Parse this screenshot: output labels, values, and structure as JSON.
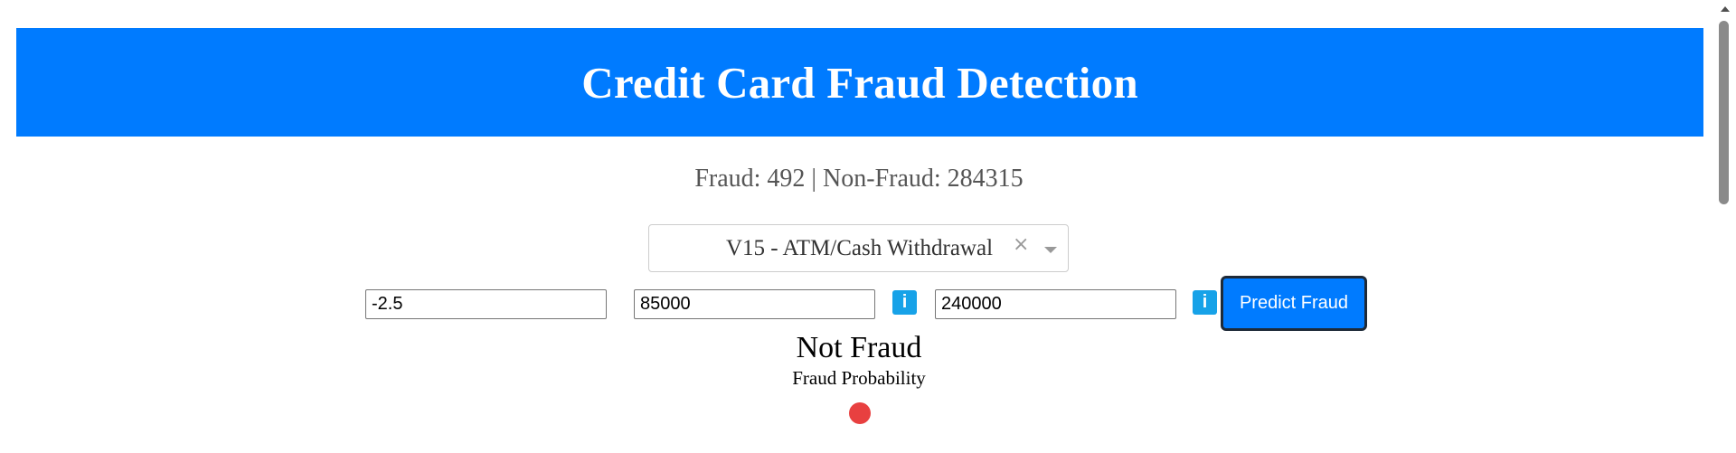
{
  "header": {
    "title": "Credit Card Fraud Detection"
  },
  "stats": {
    "text": "Fraud: 492 | Non-Fraud: 284315"
  },
  "feature_select": {
    "selected": "V15 - ATM/Cash Withdrawal",
    "clear_glyph": "×"
  },
  "inputs": {
    "feature_value": "-2.5",
    "field_2": "85000",
    "field_3": "240000"
  },
  "info_buttons": {
    "label": "i",
    "icon": "info-icon"
  },
  "predict_button": {
    "label": "Predict Fraud"
  },
  "result": {
    "prediction": "Not Fraud",
    "probability_label": "Fraud Probability",
    "indicator_color": "#e84040"
  },
  "colors": {
    "header": "#007bff",
    "button": "#007bff",
    "info": "#17a2e8"
  }
}
